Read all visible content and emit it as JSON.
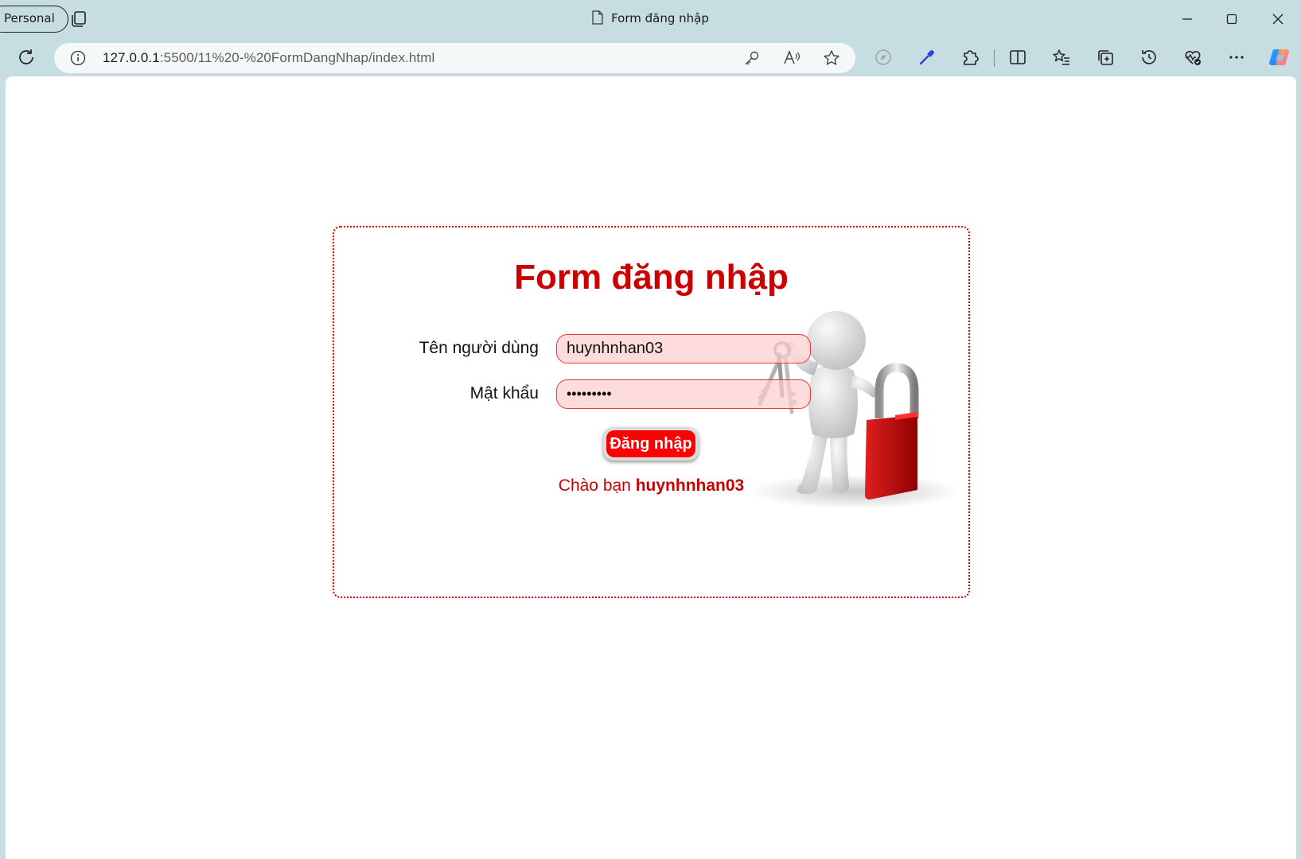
{
  "browser": {
    "profile_label": "Personal",
    "tab_title": "Form đăng nhập",
    "url_host": "127.0.0.1",
    "url_path": ":5500/11%20-%20FormDangNhap/index.html"
  },
  "form": {
    "title": "Form đăng nhập",
    "username_label": "Tên người dùng",
    "username_value": "huynhnhan03",
    "password_label": "Mật khẩu",
    "password_value": "•••••••••",
    "submit_label": "Đăng nhập",
    "greeting_prefix": "Chào bạn ",
    "greeting_name": "huynhnhan03"
  },
  "colors": {
    "accent": "#cc0000",
    "button": "#ff0000",
    "field_fill": "#ffd5d5",
    "browser_frame": "#c6dde2"
  }
}
